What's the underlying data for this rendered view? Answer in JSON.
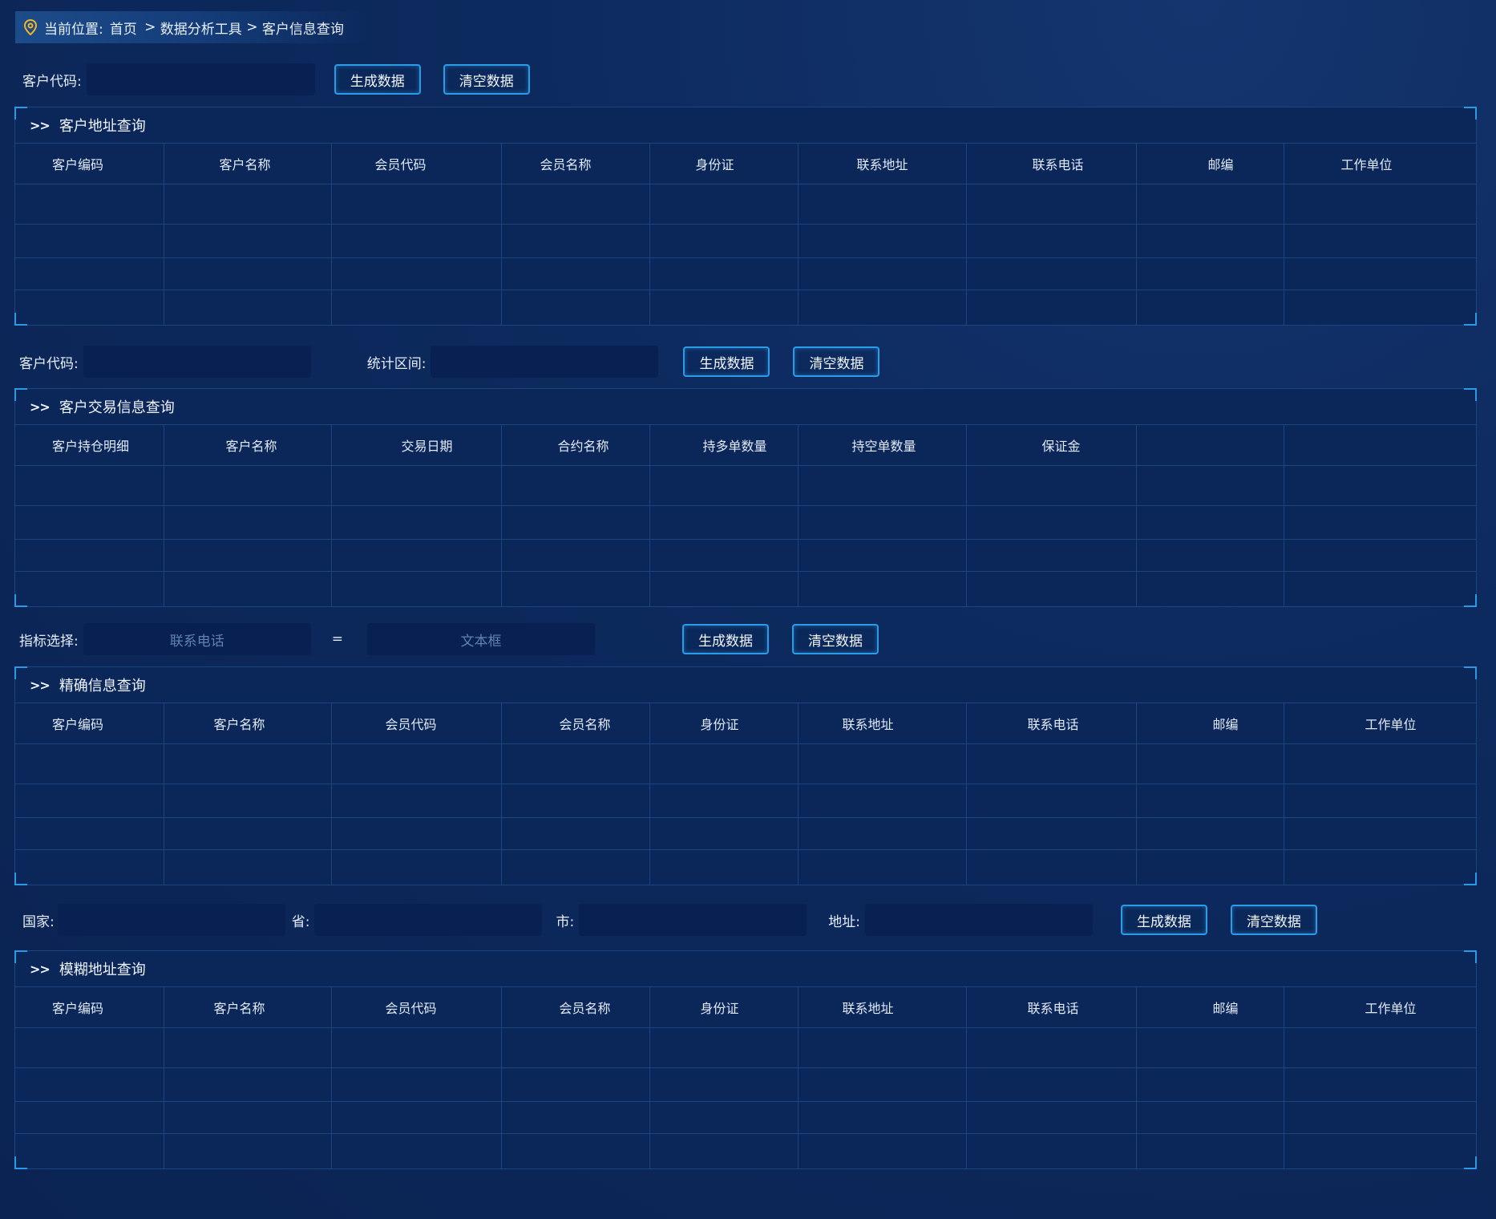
{
  "breadcrumb": {
    "label": "当前位置:",
    "home": "首页",
    "sep1": " > ",
    "tools": "数据分析工具",
    "sep2": " > ",
    "current": "客户信息查询"
  },
  "buttons": {
    "generate": "生成数据",
    "clear": "清空数据"
  },
  "form1": {
    "customer_code_label": "客户代码:"
  },
  "form2": {
    "customer_code_label": "客户代码:",
    "period_label": "统计区间:"
  },
  "form3": {
    "indicator_label": "指标选择:",
    "indicator_placeholder": "联系电话",
    "equals": "=",
    "value_placeholder": "文本框"
  },
  "form4": {
    "country_label": "国家:",
    "province_label": "省:",
    "city_label": "市:",
    "address_label": "地址:"
  },
  "panels": [
    {
      "title": "客户地址查询",
      "columns": [
        "客户编码",
        "客户名称",
        "会员代码",
        "会员名称",
        "身份证",
        "联系地址",
        "联系电话",
        "邮编",
        "工作单位"
      ]
    },
    {
      "title": "客户交易信息查询",
      "columns": [
        "客户持仓明细",
        "客户名称",
        "交易日期",
        "合约名称",
        "持多单数量",
        "持空单数量",
        "保证金",
        "",
        ""
      ]
    },
    {
      "title": "精确信息查询",
      "columns": [
        "客户编码",
        "客户名称",
        "会员代码",
        "会员名称",
        "身份证",
        "联系地址",
        "联系电话",
        "邮编",
        "工作单位"
      ]
    },
    {
      "title": "模糊地址查询",
      "columns": [
        "客户编码",
        "客户名称",
        "会员代码",
        "会员名称",
        "身份证",
        "联系地址",
        "联系电话",
        "邮编",
        "工作单位"
      ]
    }
  ],
  "colors": {
    "accent": "#2c9be8",
    "panel_bg": "#0b2659",
    "page_bg": "#0c2a5c",
    "input_bg": "#082052"
  },
  "icons": {
    "breadcrumb": "location-pin-icon"
  }
}
